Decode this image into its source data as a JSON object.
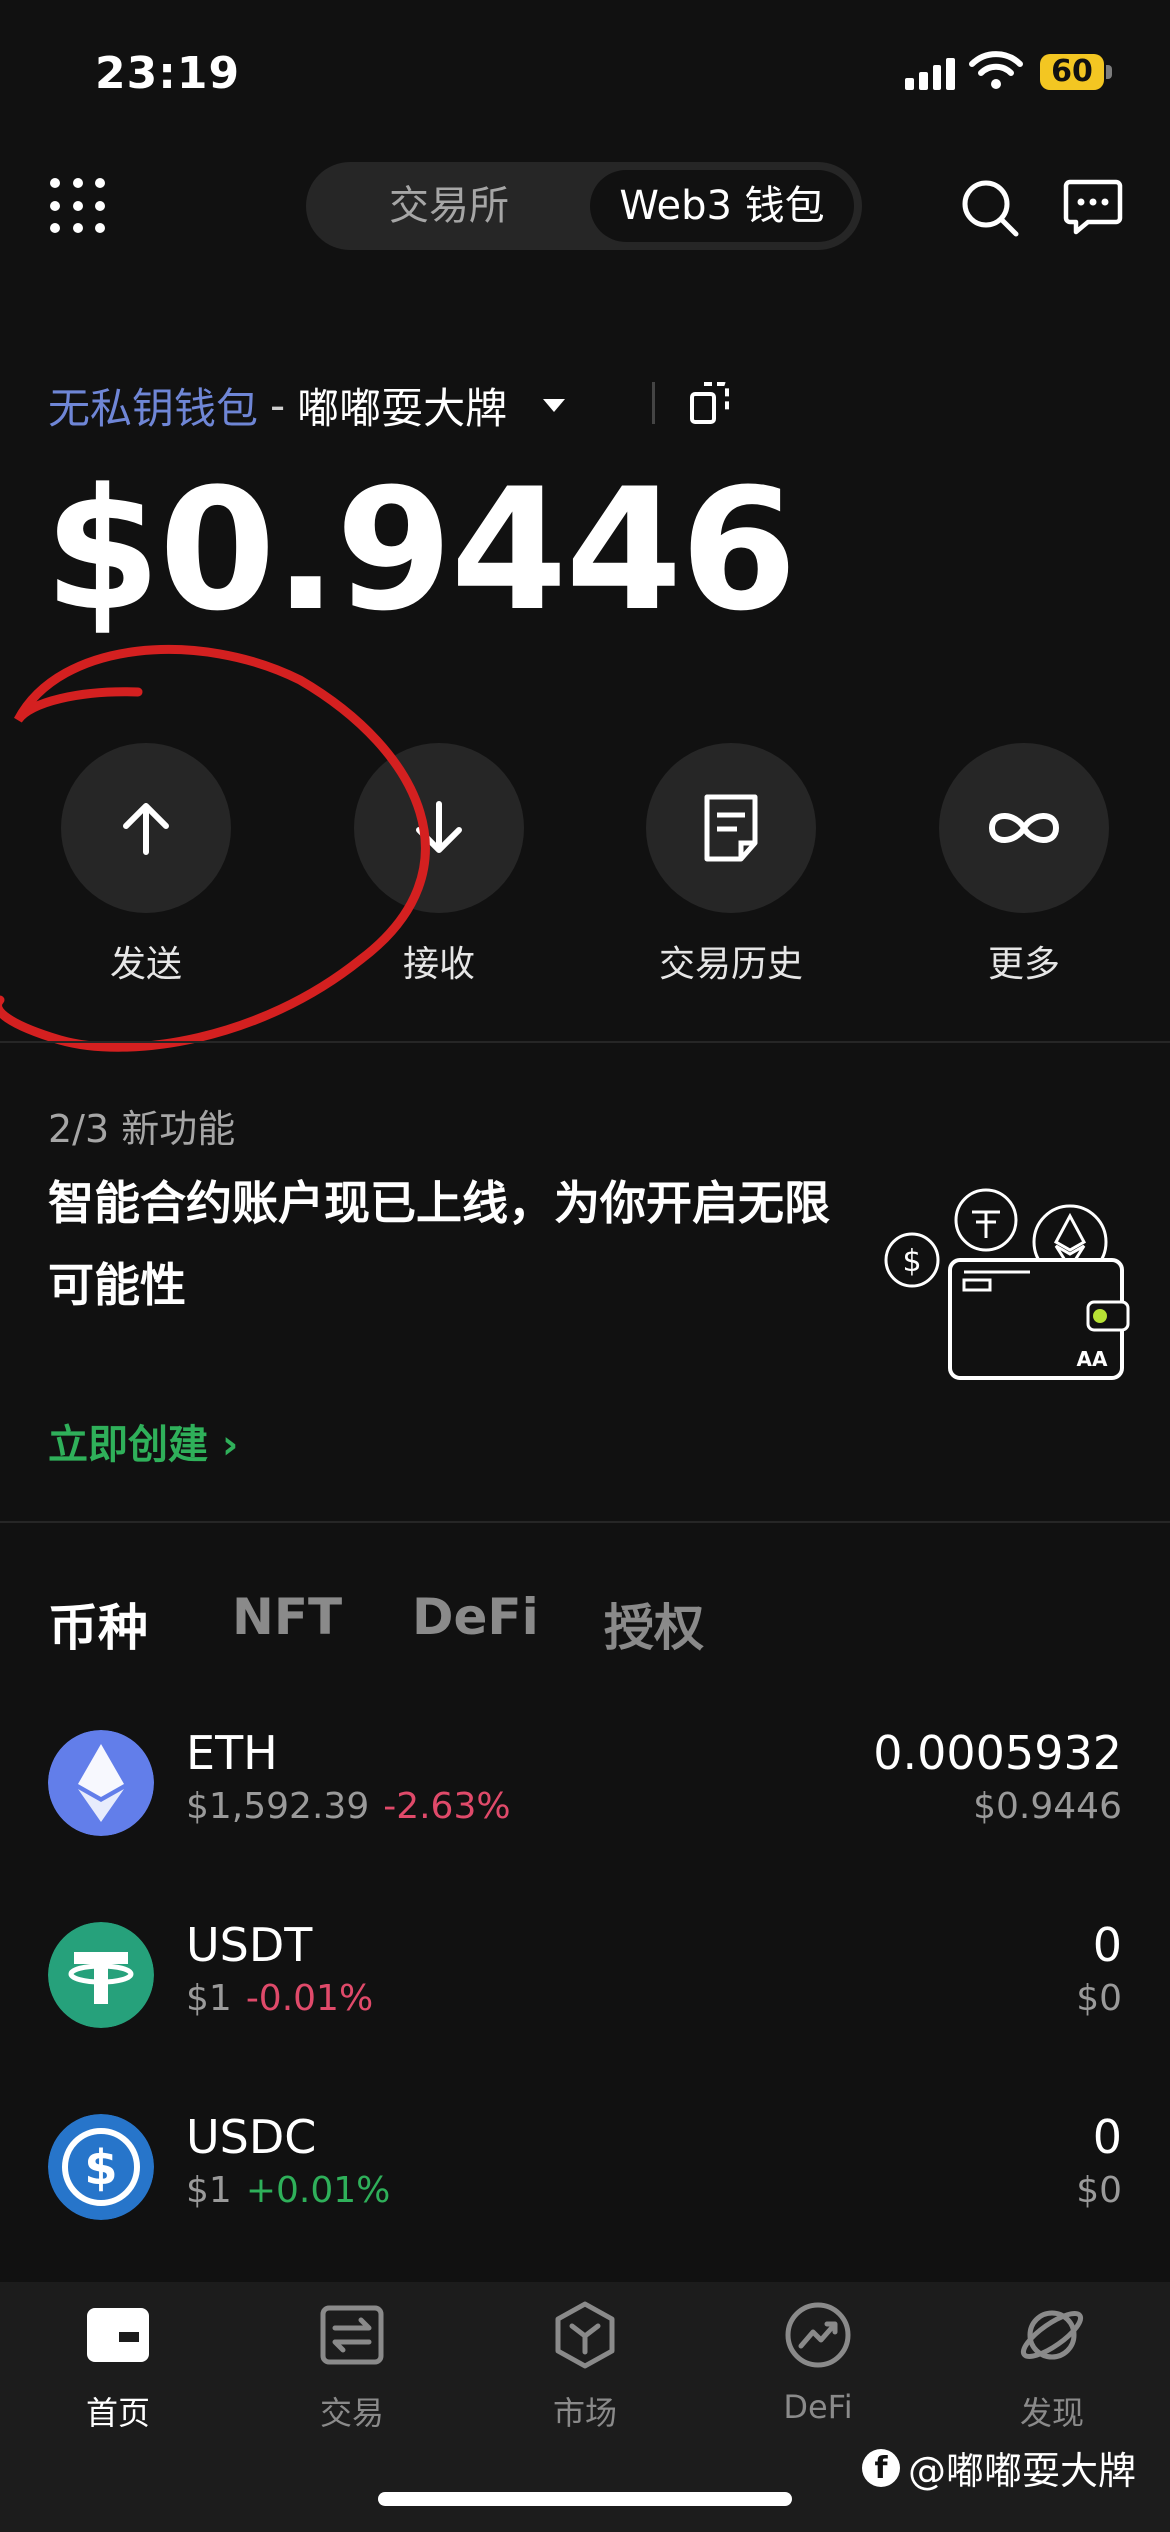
{
  "status_bar": {
    "time": "23:19",
    "battery": "60"
  },
  "header": {
    "tabs": [
      {
        "label": "交易所"
      },
      {
        "label": "Web3 钱包"
      }
    ],
    "active_tab": "Web3 钱包"
  },
  "wallet": {
    "type_label": "无私钥钱包",
    "separator": "-",
    "name": "嘟嘟耍大牌",
    "balance": "$0.9446"
  },
  "actions": [
    {
      "label": "发送",
      "icon": "arrow-up-icon"
    },
    {
      "label": "接收",
      "icon": "arrow-down-icon"
    },
    {
      "label": "交易历史",
      "icon": "document-icon"
    },
    {
      "label": "更多",
      "icon": "infinity-icon"
    }
  ],
  "promo": {
    "step": "2/3 新功能",
    "text": "智能合约账户现已上线，为你开启无限可能性",
    "link": "立即创建 ›",
    "art_badge": "AA"
  },
  "asset_tabs": [
    "币种",
    "NFT",
    "DeFi",
    "授权"
  ],
  "active_asset_tab": "币种",
  "assets": [
    {
      "symbol": "ETH",
      "price": "$1,592.39",
      "change": "-2.63%",
      "amount": "0.0005932",
      "value": "$0.9446",
      "icon_color": "#627eea"
    },
    {
      "symbol": "USDT",
      "price": "$1",
      "change": "-0.01%",
      "amount": "0",
      "value": "$0",
      "icon_color": "#26a17b"
    },
    {
      "symbol": "USDC",
      "price": "$1",
      "change": "+0.01%",
      "amount": "0",
      "value": "$0",
      "icon_color": "#2775ca"
    }
  ],
  "bottom_nav": [
    {
      "label": "首页",
      "icon": "home-icon"
    },
    {
      "label": "交易",
      "icon": "swap-icon"
    },
    {
      "label": "市场",
      "icon": "market-cube-icon"
    },
    {
      "label": "DeFi",
      "icon": "defi-chart-icon"
    },
    {
      "label": "发现",
      "icon": "planet-icon"
    }
  ],
  "active_nav": "首页",
  "watermark": "@嘟嘟耍大牌",
  "colors": {
    "accent_green": "#2fb05a",
    "negative": "#e04a6a",
    "wallet_type": "#6f86d6",
    "annotation": "#d42020"
  }
}
